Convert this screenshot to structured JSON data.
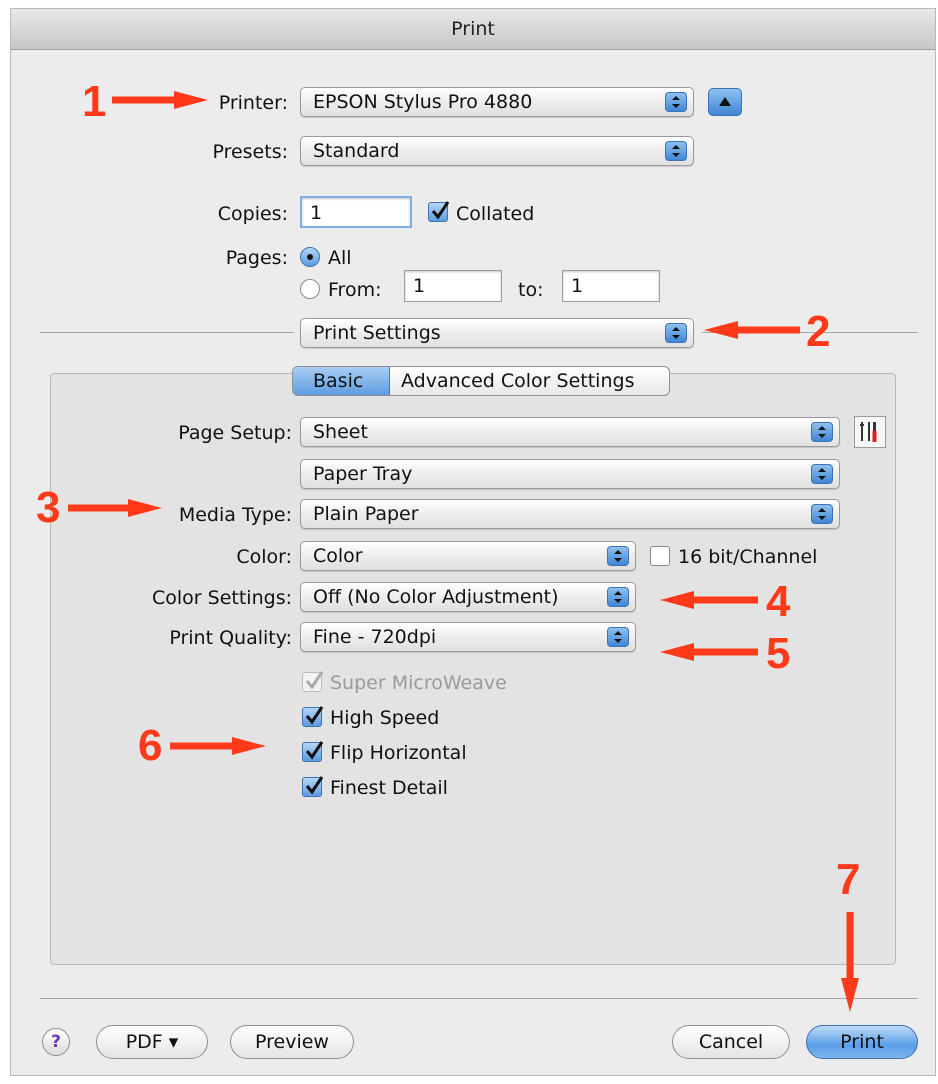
{
  "window": {
    "title": "Print"
  },
  "printer": {
    "label": "Printer:",
    "value": "EPSON Stylus Pro 4880"
  },
  "presets": {
    "label": "Presets:",
    "value": "Standard"
  },
  "copies": {
    "label": "Copies:",
    "value": "1",
    "collated_label": "Collated",
    "collated": true
  },
  "pages": {
    "label": "Pages:",
    "all_label": "All",
    "from_label": "From:",
    "from_value": "1",
    "to_label": "to:",
    "to_value": "1",
    "selected": "All"
  },
  "section_menu": {
    "value": "Print Settings"
  },
  "tabs": [
    {
      "label": "Basic",
      "selected": true
    },
    {
      "label": "Advanced Color Settings",
      "selected": false
    }
  ],
  "page_setup": {
    "label": "Page Setup:",
    "value": "Sheet"
  },
  "paper_source": {
    "value": "Paper Tray"
  },
  "media_type": {
    "label": "Media Type:",
    "value": "Plain Paper"
  },
  "color": {
    "label": "Color:",
    "value": "Color",
    "bit_label": "16 bit/Channel",
    "bit_checked": false
  },
  "color_settings": {
    "label": "Color Settings:",
    "value": "Off (No Color Adjustment)"
  },
  "print_quality": {
    "label": "Print Quality:",
    "value": "Fine - 720dpi"
  },
  "options": [
    {
      "label": "Super MicroWeave",
      "checked": true,
      "enabled": false
    },
    {
      "label": "High Speed",
      "checked": true,
      "enabled": true
    },
    {
      "label": "Flip Horizontal",
      "checked": true,
      "enabled": true
    },
    {
      "label": "Finest Detail",
      "checked": true,
      "enabled": true
    }
  ],
  "footer": {
    "help_label": "?",
    "pdf_label": "PDF ▾",
    "preview_label": "Preview",
    "cancel_label": "Cancel",
    "print_label": "Print"
  },
  "annotations": [
    "1",
    "2",
    "3",
    "4",
    "5",
    "6",
    "7"
  ],
  "colors": {
    "accent": "#5b9be0",
    "annotation": "#ff3a1a"
  }
}
